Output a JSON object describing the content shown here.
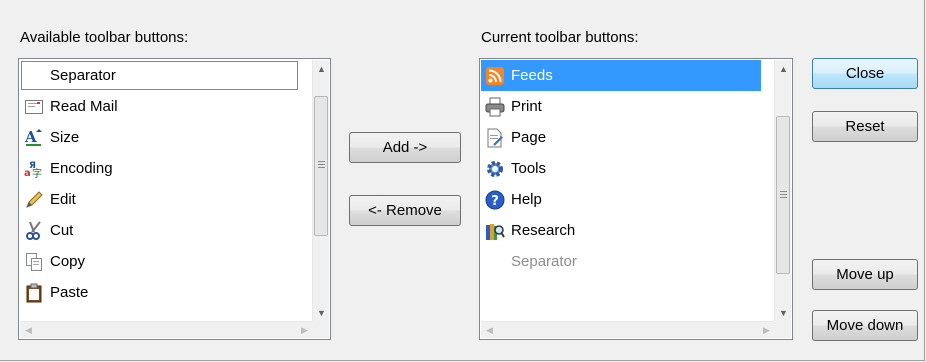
{
  "available": {
    "label": "Available toolbar buttons:",
    "items": [
      {
        "label": "Separator",
        "icon": "none"
      },
      {
        "label": "Read Mail",
        "icon": "read-mail-icon"
      },
      {
        "label": "Size",
        "icon": "text-size-icon"
      },
      {
        "label": "Encoding",
        "icon": "encoding-icon"
      },
      {
        "label": "Edit",
        "icon": "pencil-icon"
      },
      {
        "label": "Cut",
        "icon": "scissors-icon"
      },
      {
        "label": "Copy",
        "icon": "copy-icon"
      },
      {
        "label": "Paste",
        "icon": "clipboard-icon"
      }
    ],
    "focused_index": 0
  },
  "current": {
    "label": "Current toolbar buttons:",
    "items": [
      {
        "label": "Feeds",
        "icon": "rss-feed-icon"
      },
      {
        "label": "Print",
        "icon": "printer-icon"
      },
      {
        "label": "Page",
        "icon": "page-icon"
      },
      {
        "label": "Tools",
        "icon": "gear-icon"
      },
      {
        "label": "Help",
        "icon": "help-icon"
      },
      {
        "label": "Research",
        "icon": "research-icon"
      },
      {
        "label": "Separator",
        "icon": "none"
      }
    ],
    "selected_index": 0
  },
  "buttons": {
    "add": "Add ->",
    "remove": "<- Remove",
    "close": "Close",
    "reset": "Reset",
    "move_up": "Move up",
    "move_down": "Move down"
  },
  "colors": {
    "selection": "#3399ff",
    "background": "#f0f0f0"
  }
}
